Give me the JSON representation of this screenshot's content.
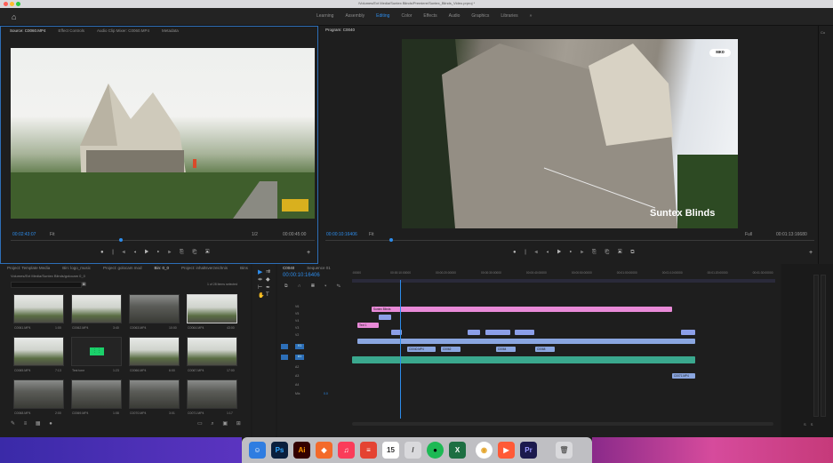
{
  "window": {
    "title": "/Volumes/Ext Media/Suntex Blinds/Premiere/Suntex_Blinds_Video.prproj *"
  },
  "menubar": {
    "workspaces": [
      "Learning",
      "Assembly",
      "Editing",
      "Color",
      "Effects",
      "Audio",
      "Graphics",
      "Libraries",
      "»"
    ],
    "active_workspace": "Editing"
  },
  "source": {
    "tabs": [
      "Source: C0060.MP4",
      "Effect Controls",
      "Audio Clip Mixer: C0060.MP4",
      "Metadata"
    ],
    "timecode": "00:02:43:07",
    "fit": "Fit",
    "scale": "1/2",
    "duration": "00:00:45:00"
  },
  "program": {
    "tab": "Program: C0040",
    "timecode": "00:00:10:16406",
    "fit": "Fit",
    "scale": "Full",
    "duration": "00:01:13:16680",
    "overlay_text": "Suntex Blinds",
    "watermark": "ᴍᴋᴏ"
  },
  "project": {
    "tabs": [
      "Project: Template Media",
      "Bin: logo_music",
      "Project: golocam mod",
      "Bin: 0_0",
      "Project: inhaltsverzeichnis",
      "Bins"
    ],
    "active_tab": "Bin: 0_0",
    "path": "Volumes/Ext Media/Suntex Blinds/golocam 0_0",
    "items_selected": "1 of 28 items selected",
    "items": [
      {
        "name": "C0061.MP4",
        "duration": "1:00",
        "style": "light"
      },
      {
        "name": "C0062.MP4",
        "duration": "3:40",
        "style": "light"
      },
      {
        "name": "C0063.MP4",
        "duration": "10:00",
        "style": "dark"
      },
      {
        "name": "C0064.MP4",
        "duration": "43:00",
        "style": "light"
      },
      {
        "name": "C0065.MP4",
        "duration": "7:13",
        "style": "light"
      },
      {
        "name": "Test tone",
        "duration": "1:23",
        "style": "green"
      },
      {
        "name": "C0066.MP4",
        "duration": "6:00",
        "style": "light"
      },
      {
        "name": "C0067.MP4",
        "duration": "17:00",
        "style": "light"
      },
      {
        "name": "C0068.MP4",
        "duration": "2:00",
        "style": "dark"
      },
      {
        "name": "C0069.MP4",
        "duration": "1:08",
        "style": "dark"
      },
      {
        "name": "C0070.MP4",
        "duration": "3:01",
        "style": "dark"
      },
      {
        "name": "C0071.MP4",
        "duration": "1:17",
        "style": "dark"
      }
    ]
  },
  "timeline": {
    "tabs": [
      "C0040",
      "Sequence 01"
    ],
    "timecode": "00:00:10:16406",
    "ruler": [
      ":00000",
      "00:00:10:00000",
      "00:00:20:00000",
      "00:00:30:00000",
      "00:00:40:00000",
      "00:00:50:00000",
      "00:01:00:00000",
      "00:01:10:00000",
      "00:01:20:00000",
      "00:01:30:00000",
      "00:01:40:0"
    ],
    "tracks": [
      "V6",
      "V5",
      "V4",
      "V3",
      "V2",
      "V1",
      "A1",
      "A2",
      "A3",
      "A4"
    ],
    "mix_label": "Mix",
    "mix_value": "0.0",
    "clips": {
      "pink": "Suntex Blinds",
      "pink_small": "Text 1",
      "v1_labels": [
        "C0040.MP4",
        "C0062",
        "C0064",
        "C0068",
        "C0071"
      ],
      "a3_label": "C0071.MP4"
    }
  },
  "colors": {
    "accent": "#2d8ceb",
    "clip_pink": "#e98ad8",
    "clip_blue": "#8c9fe8",
    "clip_audio": "#3aa88e"
  },
  "dock": {
    "apps": [
      {
        "name": "Finder",
        "label": "☺",
        "color": "#2f7de1"
      },
      {
        "name": "Photoshop",
        "label": "Ps",
        "color": "#0a1f3d"
      },
      {
        "name": "Illustrator",
        "label": "Ai",
        "color": "#330000"
      },
      {
        "name": "Brave",
        "label": "◆",
        "color": "#f36a2a"
      },
      {
        "name": "Music",
        "label": "♫",
        "color": "#fa3c5a"
      },
      {
        "name": "Todoist",
        "label": "≡",
        "color": "#e44332"
      },
      {
        "name": "Calendar",
        "label": "15",
        "color": "#ffffff"
      },
      {
        "name": "Script",
        "label": "/",
        "color": "#d9d9dc"
      },
      {
        "name": "Spotify",
        "label": "●",
        "color": "#1db954"
      },
      {
        "name": "Excel",
        "label": "X",
        "color": "#1d6f42"
      },
      {
        "name": "Chrome",
        "label": "◉",
        "color": "#ffffff"
      },
      {
        "name": "Screen",
        "label": "▶",
        "color": "#ff5a36"
      },
      {
        "name": "Premiere",
        "label": "Pr",
        "color": "#1c1a4d"
      },
      {
        "name": "Trash",
        "label": "🗑",
        "color": "#d9d9dc"
      }
    ]
  }
}
